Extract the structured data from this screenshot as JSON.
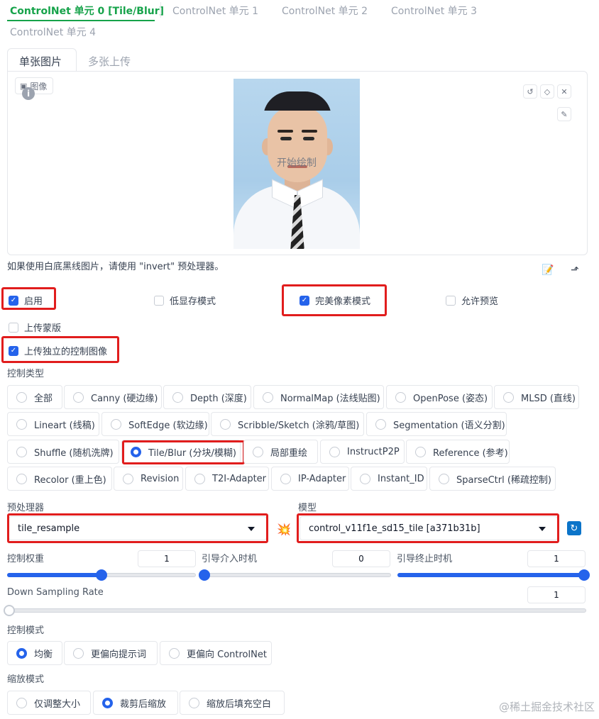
{
  "unit_tabs": [
    "ControlNet 单元 0 [Tile/Blur]",
    "ControlNet 单元 1",
    "ControlNet 单元 2",
    "ControlNet 单元 3",
    "ControlNet 单元 4"
  ],
  "image_tabs": [
    "单张图片",
    "多张上传"
  ],
  "image_panel": {
    "label": "图像",
    "info": "i",
    "overlay_text": "开始绘制",
    "tools": [
      "↺",
      "◇",
      "✕",
      "✎"
    ]
  },
  "hint_text": "如果使用白底黑线图片，请使用 \"invert\" 预处理器。",
  "hint_icons": [
    "📝",
    "⬏"
  ],
  "options": {
    "enable": "启用",
    "low_vram": "低显存模式",
    "pixel_perfect": "完美像素模式",
    "allow_preview": "允许预览",
    "upload_mask": "上传蒙版",
    "upload_independent": "上传独立的控制图像"
  },
  "control_type": {
    "label": "控制类型",
    "items": [
      "全部",
      "Canny (硬边缘)",
      "Depth (深度)",
      "NormalMap (法线贴图)",
      "OpenPose (姿态)",
      "MLSD (直线)",
      "Lineart (线稿)",
      "SoftEdge (软边缘)",
      "Scribble/Sketch (涂鸦/草图)",
      "Segmentation (语义分割)",
      "Shuffle (随机洗牌)",
      "Tile/Blur (分块/模糊)",
      "局部重绘",
      "InstructP2P",
      "Reference (参考)",
      "Recolor (重上色)",
      "Revision",
      "T2I-Adapter",
      "IP-Adapter",
      "Instant_ID",
      "SparseCtrl (稀疏控制)"
    ],
    "selected": "Tile/Blur (分块/模糊)"
  },
  "preprocessor": {
    "label": "预处理器",
    "value": "tile_resample",
    "run_icon": "💥"
  },
  "model": {
    "label": "模型",
    "value": "control_v11f1e_sd15_tile [a371b31b]",
    "refresh_icon": "↻"
  },
  "sliders": {
    "control_weight": {
      "label": "控制权重",
      "value": "1",
      "fraction": 0.5
    },
    "guidance_start": {
      "label": "引导介入时机",
      "value": "0",
      "fraction": 0.0
    },
    "guidance_end": {
      "label": "引导终止时机",
      "value": "1",
      "fraction": 1.0
    },
    "down_sampling": {
      "label": "Down Sampling Rate",
      "value": "1",
      "fraction": 0.0
    }
  },
  "control_mode": {
    "label": "控制模式",
    "items": [
      "均衡",
      "更偏向提示词",
      "更偏向 ControlNet"
    ],
    "selected": "均衡"
  },
  "resize_mode": {
    "label": "缩放模式",
    "items": [
      "仅调整大小",
      "裁剪后缩放",
      "缩放后填充空白"
    ],
    "selected": "裁剪后缩放"
  },
  "watermark": "@稀土掘金技术社区",
  "colors": {
    "accent": "#2563eb",
    "active_tab": "#16a34a",
    "highlight": "#e11d1d"
  }
}
